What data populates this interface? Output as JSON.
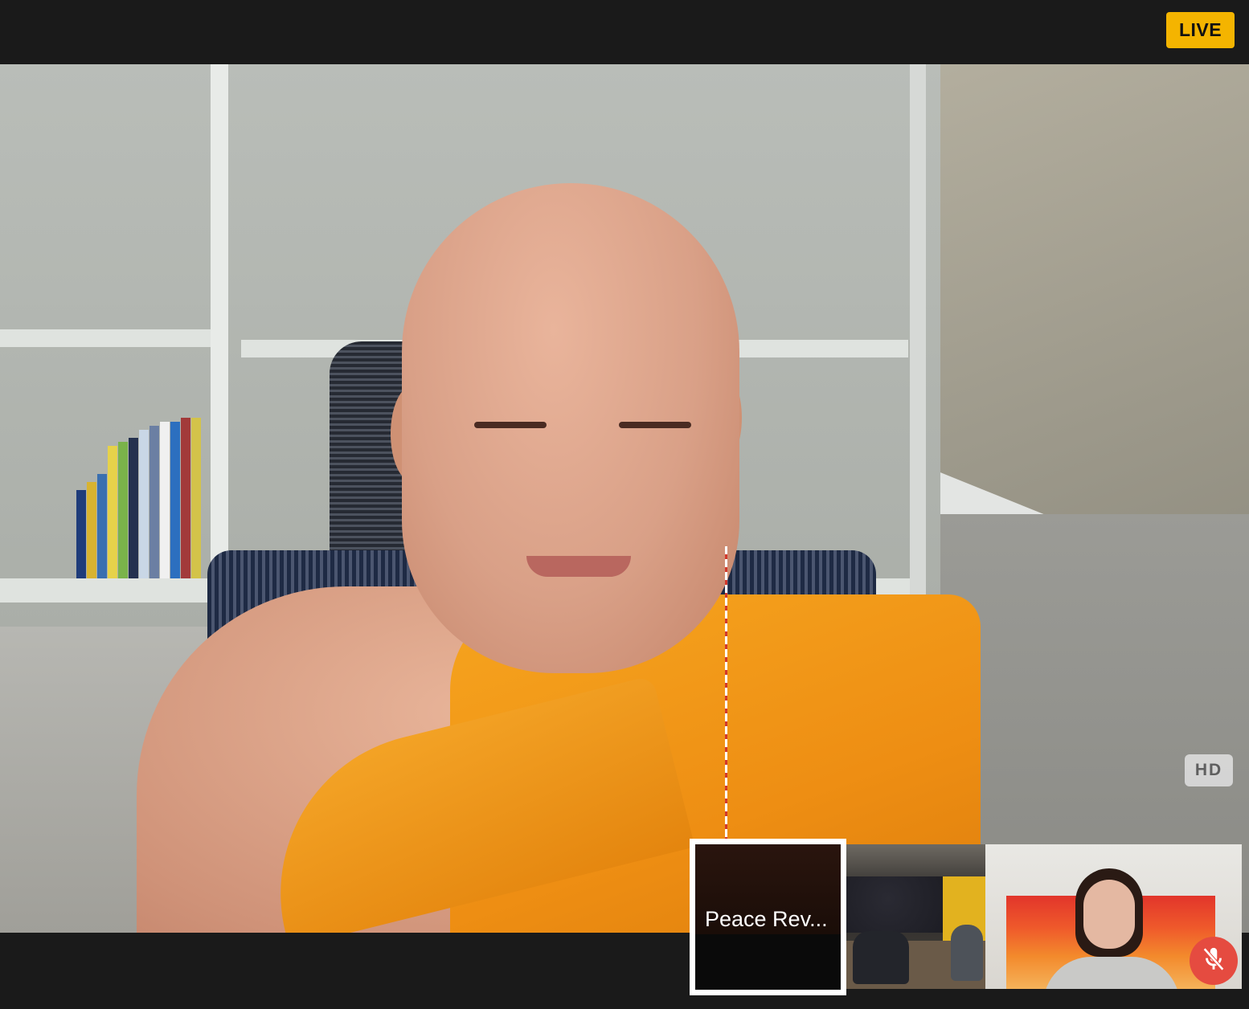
{
  "header": {
    "live_label": "LIVE",
    "live_color": "#f4b400"
  },
  "main_video": {
    "quality_badge": "HD"
  },
  "participants": [
    {
      "label": "Peace Rev...",
      "active": true
    },
    {
      "label": "",
      "active": false
    },
    {
      "label": "",
      "active": false,
      "muted": true
    }
  ],
  "icons": {
    "mute": "mic-off-icon"
  },
  "colors": {
    "background": "#1a1a1a",
    "mute": "#e54b40",
    "active_border": "#ffffff"
  }
}
